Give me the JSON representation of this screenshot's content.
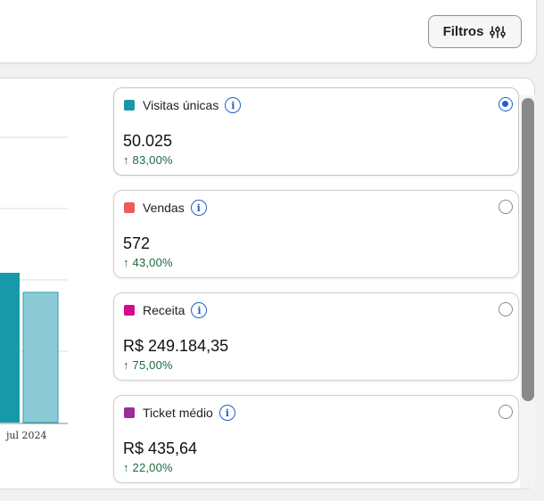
{
  "toolbar": {
    "filter_label": "Filtros"
  },
  "chart_data": {
    "type": "bar",
    "categories": [
      "",
      "jul 2024"
    ],
    "series": [
      {
        "values": [
          null,
          36
        ]
      }
    ],
    "x_tick_label": "jul 2024",
    "colors": {
      "dark_bar": "#1899aa",
      "light_bar": "#8ccbd6"
    }
  },
  "cards": [
    {
      "label": "Visitas únicas",
      "value": "50.025",
      "delta": "83,00%",
      "color": "#1897a9",
      "selected": true
    },
    {
      "label": "Vendas",
      "value": "572",
      "delta": "43,00%",
      "color": "#ef5b5b",
      "selected": false
    },
    {
      "label": "Receita",
      "value": "R$ 249.184,35",
      "delta": "75,00%",
      "color": "#d6088e",
      "selected": false
    },
    {
      "label": "Ticket médio",
      "value": "R$ 435,64",
      "delta": "22,00%",
      "color": "#9b2c9b",
      "selected": false
    }
  ],
  "delta_arrow": "↑"
}
